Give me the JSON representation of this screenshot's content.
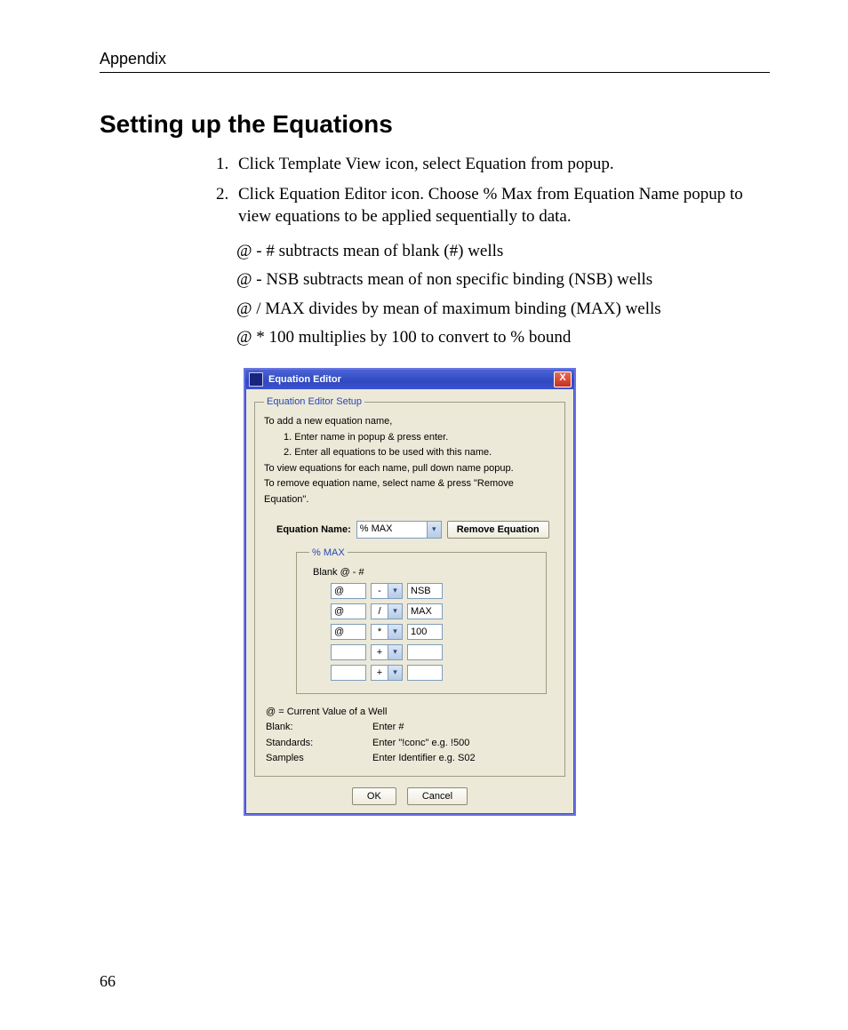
{
  "header": "Appendix",
  "title": "Setting up the Equations",
  "steps": [
    "Click Template View icon, select Equation from popup.",
    "Click Equation Editor icon.   Choose % Max from Equation  Name popup to view equations to be applied sequentially to data."
  ],
  "equations_text": [
    "@  -  #       subtracts mean of blank (#) wells",
    "@  -  NSB  subtracts mean of non specific binding (NSB) wells",
    "@  /  MAX divides by mean of maximum binding (MAX) wells",
    "@  *  100    multiplies by 100 to convert to % bound"
  ],
  "page_number": "66",
  "dialog": {
    "title": "Equation Editor",
    "close_glyph": "X",
    "group_legend": "Equation Editor Setup",
    "instructions": {
      "intro": "To add a new equation name,",
      "step1": "1. Enter name in popup & press enter.",
      "step2": "2. Enter all equations to be used with this name.",
      "view": "To view equations for each name, pull down name popup.",
      "remove": "To remove equation name, select name & press \"Remove Equation\"."
    },
    "name_label": "Equation Name:",
    "name_value": "% MAX",
    "remove_button": "Remove Equation",
    "inner_legend": "% MAX",
    "blank_line": "Blank   @ - #",
    "rows": [
      {
        "lhs": "@",
        "op": "-",
        "rhs": "NSB"
      },
      {
        "lhs": "@",
        "op": "/",
        "rhs": "MAX"
      },
      {
        "lhs": "@",
        "op": "*",
        "rhs": "100"
      },
      {
        "lhs": "",
        "op": "+",
        "rhs": ""
      },
      {
        "lhs": "",
        "op": "+",
        "rhs": ""
      }
    ],
    "legend": {
      "at": "@ = Current Value of a Well",
      "blank_k": "Blank:",
      "blank_v": "Enter #",
      "std_k": "Standards:",
      "std_v": "Enter \"!conc\"   e.g. !500",
      "samp_k": "Samples",
      "samp_v": "Enter Identifier   e.g. S02"
    },
    "ok": "OK",
    "cancel": "Cancel",
    "dd_glyph": "▾"
  }
}
